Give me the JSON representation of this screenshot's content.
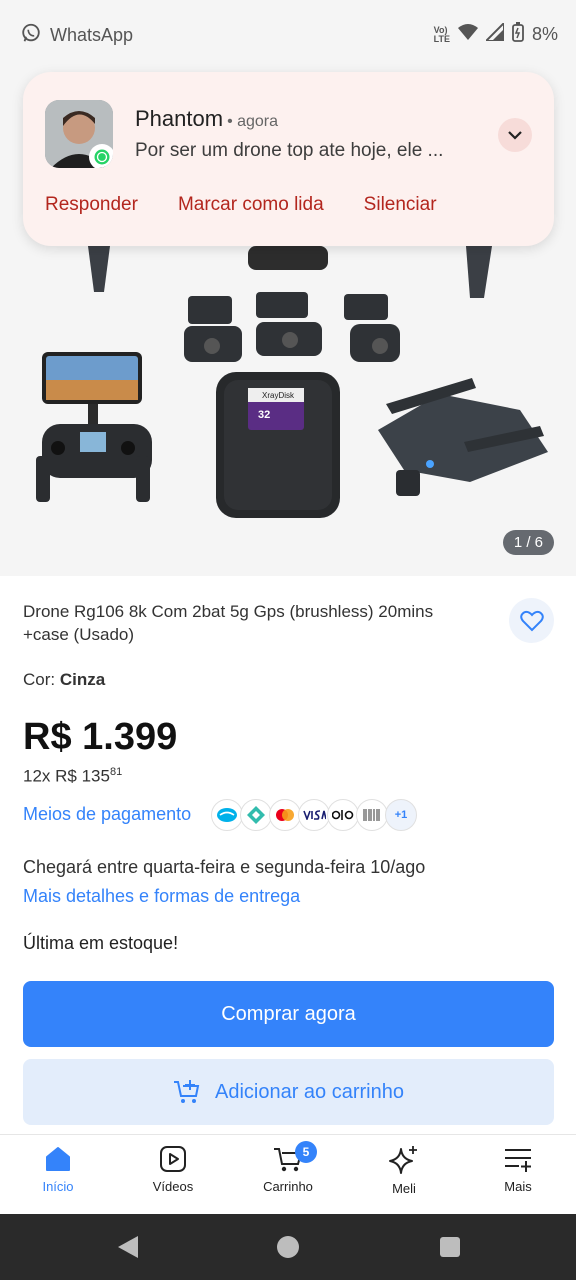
{
  "status_bar": {
    "app_name": "WhatsApp",
    "network": "Vo LTE",
    "battery": "8%"
  },
  "gallery": {
    "page_indicator": "1 / 6",
    "sd_card_label": "XrayDisk",
    "sd_card_capacity": "32"
  },
  "notification": {
    "sender": "Phantom",
    "time": "• agora",
    "message": "Por ser um drone top ate hoje, ele ...",
    "actions": [
      "Responder",
      "Marcar como lida",
      "Silenciar"
    ]
  },
  "product": {
    "title": "Drone Rg106 8k Com 2bat 5g Gps (brushless) 20mins +case (Usado)",
    "color_label": "Cor:",
    "color_value": "Cinza",
    "price": "R$ 1.399",
    "installments_main": "12x R$ 135",
    "installments_cents": "81",
    "payment_link": "Meios de pagamento",
    "payment_more": "+1",
    "delivery_text": "Chegará entre quarta-feira e segunda-feira 10/ago",
    "delivery_link": "Mais detalhes e formas de entrega",
    "stock": "Última em estoque!",
    "buy_label": "Comprar agora",
    "cart_label": "Adicionar ao carrinho"
  },
  "payment_icons": [
    "mercado-pago-icon",
    "pix-icon",
    "mastercard-icon",
    "visa-icon",
    "elo-icon",
    "boleto-icon"
  ],
  "bottom_nav": {
    "items": [
      {
        "label": "Início",
        "icon": "home-icon",
        "active": true
      },
      {
        "label": "Vídeos",
        "icon": "video-icon"
      },
      {
        "label": "Carrinho",
        "icon": "cart-icon",
        "badge": "5"
      },
      {
        "label": "Meli",
        "icon": "sparkle-icon"
      },
      {
        "label": "Mais",
        "icon": "menu-plus-icon"
      }
    ]
  },
  "colors": {
    "accent": "#3483fa",
    "notification_action": "#b3261e",
    "notification_bg": "#fdf1ef"
  }
}
